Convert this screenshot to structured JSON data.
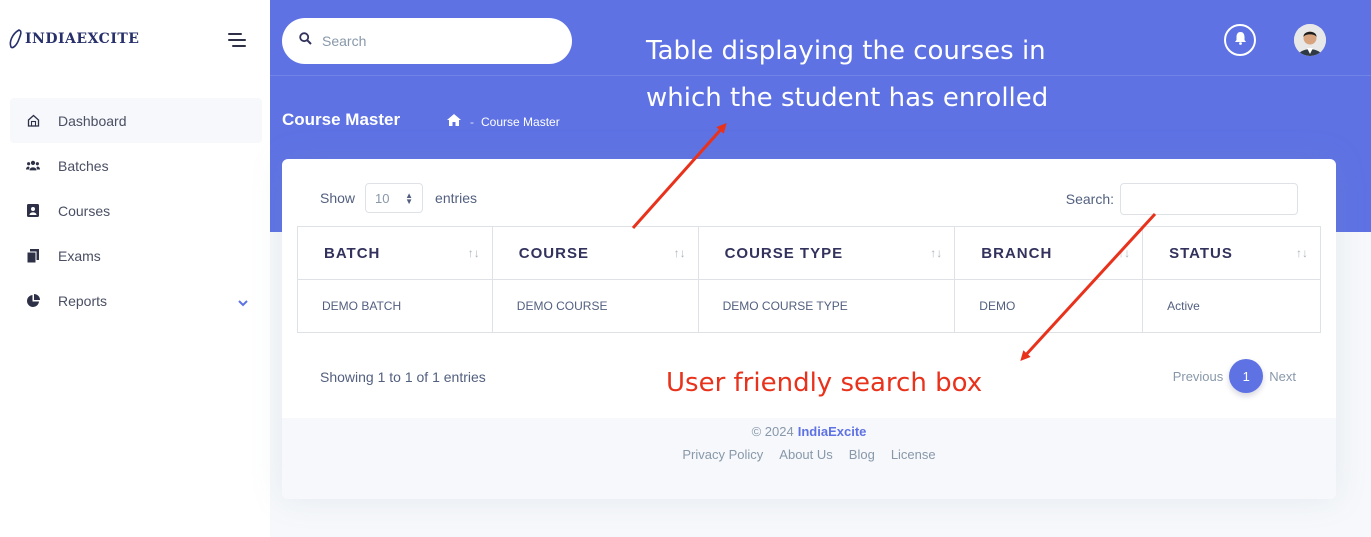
{
  "sidebar": {
    "brand": "INDIAEXCITE",
    "items": [
      {
        "label": "Dashboard"
      },
      {
        "label": "Batches"
      },
      {
        "label": "Courses"
      },
      {
        "label": "Exams"
      },
      {
        "label": "Reports"
      }
    ]
  },
  "header": {
    "search_placeholder": "Search",
    "page_title": "Course Master",
    "breadcrumb_sep": "-",
    "breadcrumb_current": "Course Master"
  },
  "annotations": {
    "table_note_line1": "Table displaying the courses in",
    "table_note_line2": "which the student has enrolled",
    "search_note": "User friendly search box",
    "color": "#e8321c"
  },
  "table": {
    "show_label": "Show",
    "length_value": "10",
    "entries_label": "entries",
    "search_label": "Search:",
    "columns": [
      "BATCH",
      "COURSE",
      "COURSE TYPE",
      "BRANCH",
      "STATUS"
    ],
    "rows": [
      [
        "DEMO BATCH",
        "DEMO COURSE",
        "DEMO COURSE TYPE",
        "DEMO",
        "Active"
      ]
    ],
    "info": "Showing 1 to 1 of 1 entries",
    "pagination": {
      "previous": "Previous",
      "current": "1",
      "next": "Next"
    }
  },
  "footer": {
    "copyright": "© 2024",
    "brand": "IndiaExcite",
    "links": [
      "Privacy Policy",
      "About Us",
      "Blog",
      "License"
    ]
  },
  "colors": {
    "primary": "#5e72e4",
    "background": "#f6f8fb",
    "annotation": "#e8321c"
  }
}
